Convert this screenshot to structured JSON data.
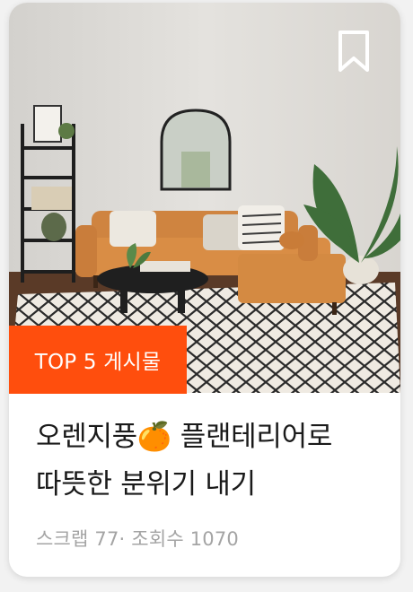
{
  "post": {
    "badge": "TOP 5 게시물",
    "title_line1": "오렌지풍🍊 플랜테리어로",
    "title_line2": "따뜻한 분위기 내기",
    "meta": "스크랩 77· 조회수 1070"
  },
  "icons": {
    "bookmark": "bookmark-icon"
  },
  "colors": {
    "badge_bg": "#ff4e0d",
    "title_text": "#1a1a1a",
    "meta_text": "#a4a4a4",
    "sofa": "#d98d45"
  }
}
